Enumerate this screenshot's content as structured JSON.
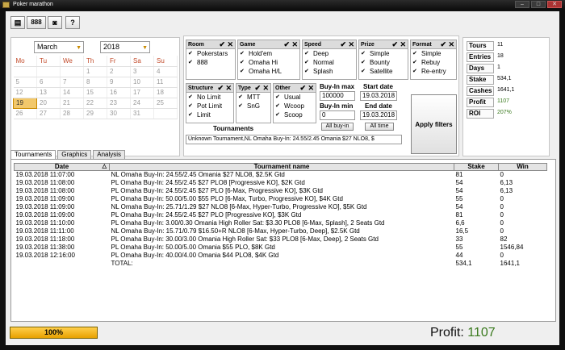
{
  "window": {
    "title": "Poker marathon"
  },
  "toolbar": {
    "btn1": "▤",
    "btn2": "888",
    "btn3": "◙",
    "btn4": "?"
  },
  "calendar": {
    "month": "March",
    "year": "2018",
    "weekdays": [
      "Mo",
      "Tu",
      "We",
      "Th",
      "Fr",
      "Sa",
      "Su"
    ],
    "weeks": [
      [
        "",
        "",
        "",
        "1",
        "2",
        "3",
        "4"
      ],
      [
        "5",
        "6",
        "7",
        "8",
        "9",
        "10",
        "11"
      ],
      [
        "12",
        "13",
        "14",
        "15",
        "16",
        "17",
        "18"
      ],
      [
        "19",
        "20",
        "21",
        "22",
        "23",
        "24",
        "25"
      ],
      [
        "26",
        "27",
        "28",
        "29",
        "30",
        "31",
        ""
      ]
    ],
    "today": "19"
  },
  "filters": {
    "room": {
      "title": "Room",
      "items": [
        "Pokerstars",
        "888"
      ]
    },
    "game": {
      "title": "Game",
      "items": [
        "Hold'em",
        "Omaha Hi",
        "Omaha H/L"
      ]
    },
    "speed": {
      "title": "Speed",
      "items": [
        "Deep",
        "Normal",
        "Splash"
      ]
    },
    "prize": {
      "title": "Prize",
      "items": [
        "Simple",
        "Bounty",
        "Satellite"
      ]
    },
    "format": {
      "title": "Format",
      "items": [
        "Simple",
        "Rebuy",
        "Re-entry"
      ]
    },
    "structure": {
      "title": "Structure",
      "items": [
        "No Limit",
        "Pot Limit",
        "Limit"
      ]
    },
    "type": {
      "title": "Type",
      "items": [
        "MTT",
        "SnG"
      ]
    },
    "other": {
      "title": "Other",
      "items": [
        "Usual",
        "Wcoop",
        "Scoop"
      ]
    },
    "buyin_max_label": "Buy-In max",
    "buyin_max": "100000",
    "buyin_min_label": "Buy-In min",
    "buyin_min": "0",
    "all_buyin": "All buy-in",
    "start_date_label": "Start date",
    "start_date": "19.03.2018",
    "end_date_label": "End date",
    "end_date": "19.03.2018",
    "all_time": "All time",
    "tournaments_label": "Tournaments",
    "tournaments_value": "Unknown Tournament,NL Omaha Buy-In: 24.55/2.45 Omania $27 NLO8, $",
    "apply": "Apply filters"
  },
  "stats": [
    {
      "k": "Tours",
      "v": "11"
    },
    {
      "k": "Entries",
      "v": "18"
    },
    {
      "k": "Days",
      "v": "1"
    },
    {
      "k": "Stake",
      "v": "534,1"
    },
    {
      "k": "Cashes",
      "v": "1641,1"
    },
    {
      "k": "Profit",
      "v": "1107"
    },
    {
      "k": "ROI",
      "v": "207%"
    }
  ],
  "tabs": [
    "Tournaments",
    "Graphics",
    "Analysis"
  ],
  "table": {
    "headers": [
      "Date",
      "Tournament name",
      "Stake",
      "Win"
    ],
    "rows": [
      [
        "19.03.2018 11:07:00",
        "NL Omaha Buy-In: 24.55/2.45 Omania $27 NLO8, $2.5K Gtd",
        "81",
        "0"
      ],
      [
        "19.03.2018 11:08:00",
        "PL Omaha Buy-In: 24.55/2.45 $27 PLO8 [Progressive KO], $2K Gtd",
        "54",
        "6,13"
      ],
      [
        "19.03.2018 11:08:00",
        "PL Omaha Buy-In: 24.55/2.45 $27 PLO [6-Max, Progressive KO], $3K Gtd",
        "54",
        "6,13"
      ],
      [
        "19.03.2018 11:09:00",
        "PL Omaha Buy-In: 50.00/5.00 $55 PLO [6-Max, Turbo, Progressive KO], $4K Gtd",
        "55",
        "0"
      ],
      [
        "19.03.2018 11:09:00",
        "NL Omaha Buy-In: 25.71/1.29 $27 NLO8 [6-Max, Hyper-Turbo, Progressive KO], $5K Gtd",
        "54",
        "0"
      ],
      [
        "19.03.2018 11:09:00",
        "PL Omaha Buy-In: 24.55/2.45 $27 PLO [Progressive KO], $3K Gtd",
        "81",
        "0"
      ],
      [
        "19.03.2018 11:10:00",
        "PL Omaha Buy-In: 3.00/0.30 Omania High Roller Sat: $3.30 PLO8 [6-Max, Splash], 2 Seats Gtd",
        "6,6",
        "0"
      ],
      [
        "19.03.2018 11:11:00",
        "NL Omaha Buy-In: 15.71/0.79 $16.50+R NLO8 [6-Max, Hyper-Turbo, Deep], $2.5K Gtd",
        "16,5",
        "0"
      ],
      [
        "19.03.2018 11:18:00",
        "PL Omaha Buy-In: 30.00/3.00 Omania High Roller Sat: $33 PLO8 [6-Max, Deep], 2 Seats Gtd",
        "33",
        "82"
      ],
      [
        "19.03.2018 11:38:00",
        "PL Omaha Buy-In: 50.00/5.00 Omania $55 PLO, $8K Gtd",
        "55",
        "1546,84"
      ],
      [
        "19.03.2018 12:16:00",
        "PL Omaha Buy-In: 40.00/4.00 Omania $44 PLO8, $4K Gtd",
        "44",
        "0"
      ],
      [
        "",
        "TOTAL:",
        "534,1",
        "1641,1"
      ]
    ]
  },
  "footer": {
    "progress": "100%",
    "progress_value": 1.0,
    "profit_label": "Profit:",
    "profit_value": "1107"
  },
  "colors": {
    "accent": "#e8a100",
    "profit": "#3a7a1e",
    "today": "#f2c86b"
  }
}
